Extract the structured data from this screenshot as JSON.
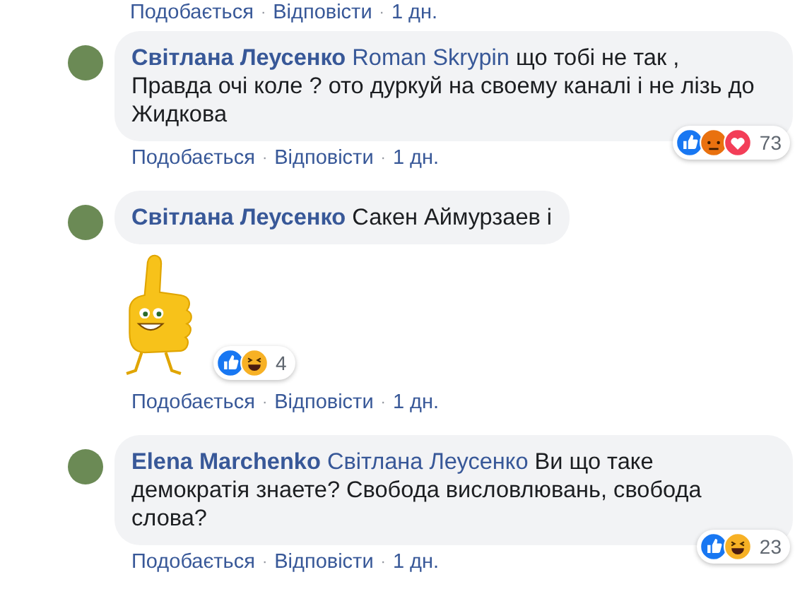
{
  "previous_actions": [
    {
      "kind": "link",
      "label": "Подобається"
    },
    {
      "kind": "separator",
      "label": "·"
    },
    {
      "kind": "link",
      "label": "Відповісти"
    },
    {
      "kind": "separator",
      "label": "·"
    },
    {
      "kind": "time",
      "label": "1 дн."
    }
  ],
  "comments": [
    {
      "author": "Світлана Леусенко",
      "mention": "Roman Skrypin",
      "text": "що тобі не так ,\nПравда очі коле ? ото дуркуй на своему каналі і не лізь до Жидкова",
      "sticker": false,
      "reactions": [
        {
          "kind": "like"
        },
        {
          "kind": "angry"
        },
        {
          "kind": "love"
        }
      ],
      "reaction_count": "73",
      "actions": [
        {
          "kind": "link",
          "label": "Подобається"
        },
        {
          "kind": "separator",
          "label": "·"
        },
        {
          "kind": "link",
          "label": "Відповісти"
        },
        {
          "kind": "separator",
          "label": "·"
        },
        {
          "kind": "time",
          "label": "1 дн."
        }
      ]
    },
    {
      "author": "Світлана Леусенко",
      "text": "Сакен Аймурзаев і",
      "sticker": true,
      "reactions": [
        {
          "kind": "like"
        },
        {
          "kind": "haha"
        }
      ],
      "reaction_count": "4",
      "actions": [
        {
          "kind": "link",
          "label": "Подобається"
        },
        {
          "kind": "separator",
          "label": "·"
        },
        {
          "kind": "link",
          "label": "Відповісти"
        },
        {
          "kind": "separator",
          "label": "·"
        },
        {
          "kind": "time",
          "label": "1 дн."
        }
      ]
    },
    {
      "author": "Elena Marchenko",
      "mention": "Світлана Леусенко",
      "text": "Ви що таке демократія знаете? Свобода висловлювань, свобода слова?",
      "sticker": false,
      "reactions": [
        {
          "kind": "like"
        },
        {
          "kind": "haha"
        }
      ],
      "reaction_count": "23",
      "actions": [
        {
          "kind": "link",
          "label": "Подобається"
        },
        {
          "kind": "separator",
          "label": "·"
        },
        {
          "kind": "link",
          "label": "Відповісти"
        },
        {
          "kind": "separator",
          "label": "·"
        },
        {
          "kind": "time",
          "label": "1 дн."
        }
      ]
    }
  ]
}
